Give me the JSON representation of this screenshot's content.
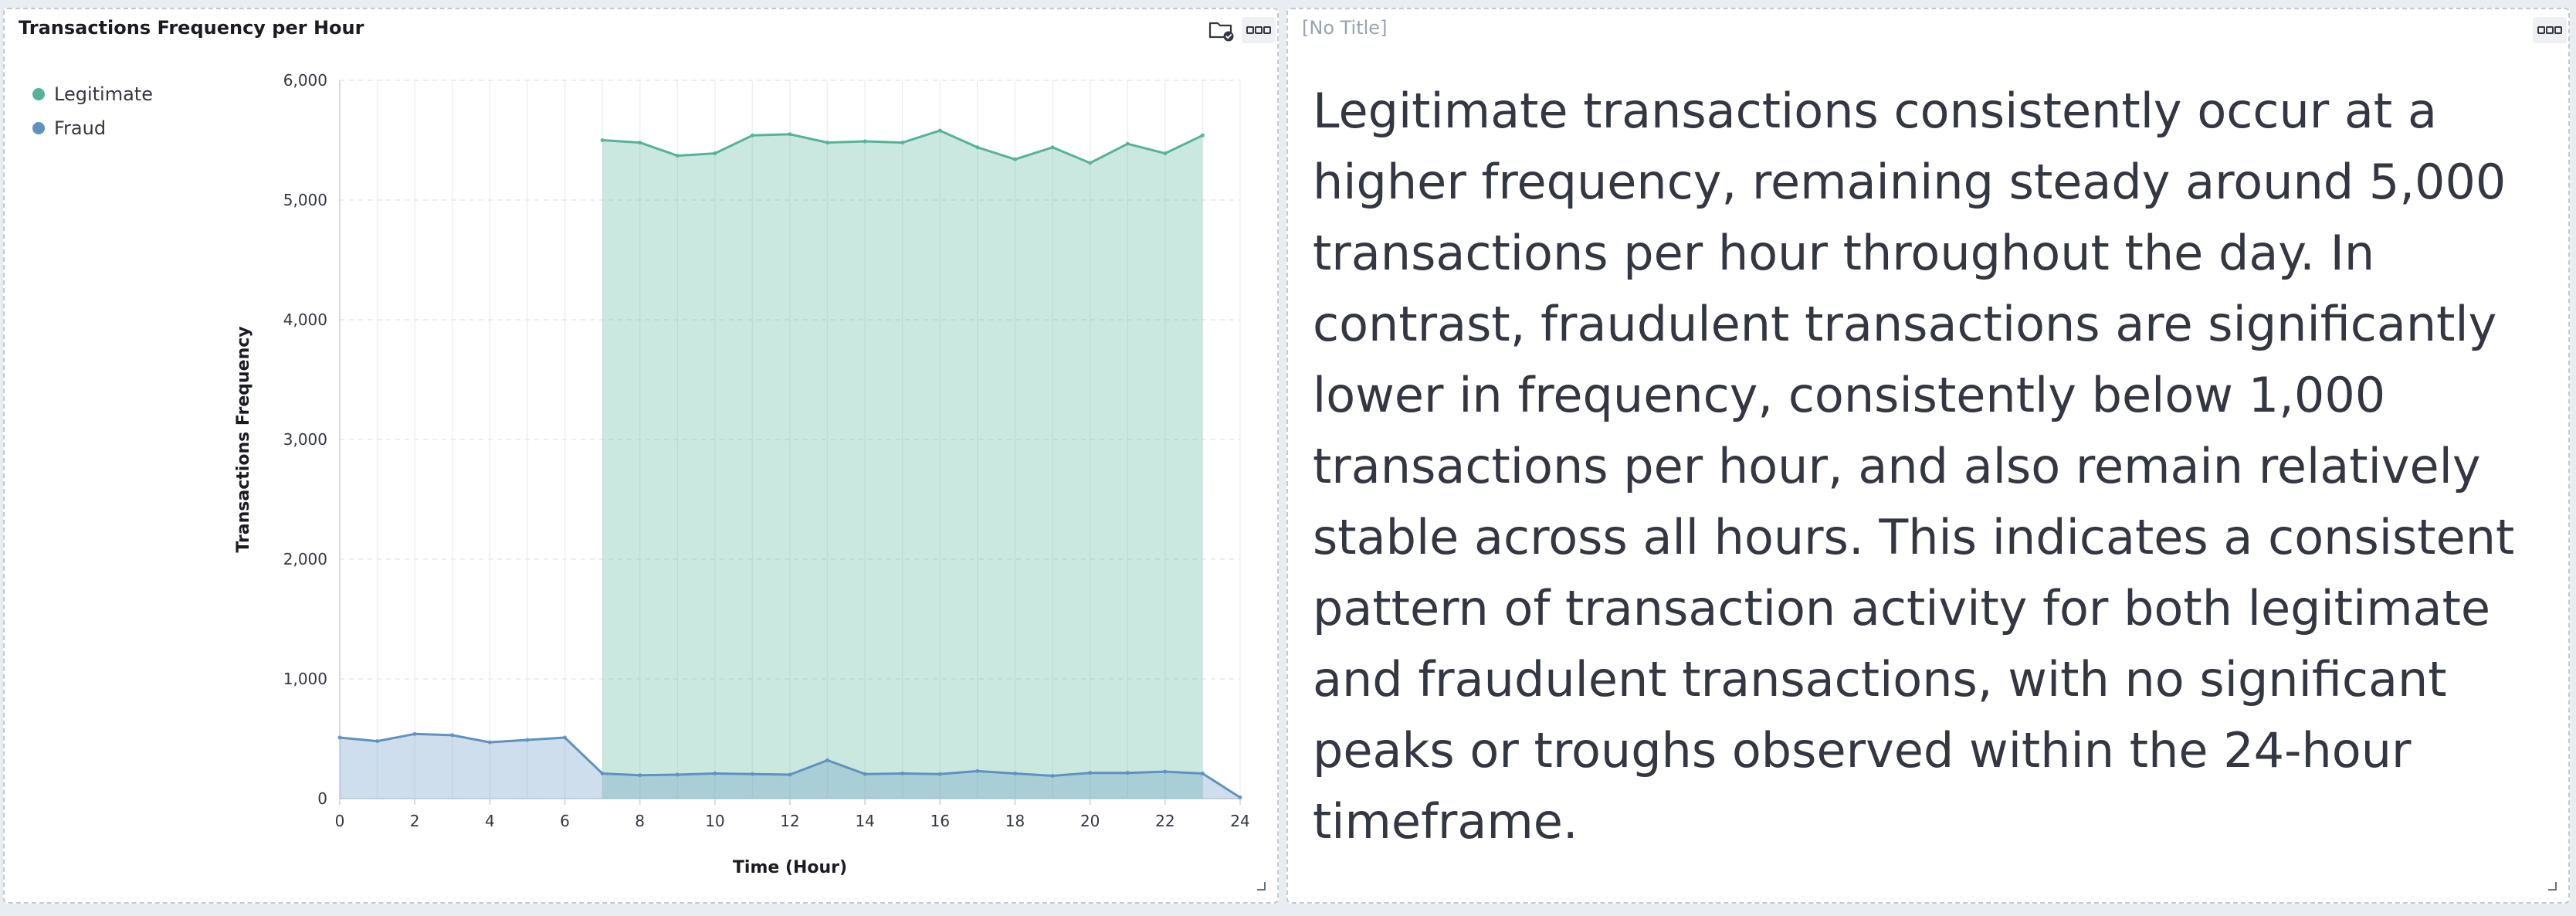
{
  "chart_panel": {
    "title": "Transactions Frequency per Hour",
    "save_icon": "folder-check-icon",
    "menu_icon": "ellipsis-icon"
  },
  "text_panel": {
    "title": "[No Title]",
    "menu_icon": "ellipsis-icon",
    "body": "Legitimate transactions consistently occur at a higher frequency, remaining steady around 5,000 transactions per hour throughout the day. In contrast, fraudulent transactions are significantly lower in frequency, consistently below 1,000 transactions per hour, and also remain relatively stable across all hours. This indicates a consistent pattern of transaction activity for both legitimate and fraudulent transactions, with no significant peaks or troughs observed within the 24-hour timeframe."
  },
  "legend": [
    {
      "label": "Legitimate",
      "color": "#54b399"
    },
    {
      "label": "Fraud",
      "color": "#6092c0"
    }
  ],
  "chart_data": {
    "type": "area",
    "title": "Transactions Frequency per Hour",
    "xlabel": "Time (Hour)",
    "ylabel": "Transactions Frequency",
    "xlim": [
      0,
      24
    ],
    "ylim": [
      0,
      6000
    ],
    "xticks": [
      "0",
      "2",
      "4",
      "6",
      "8",
      "10",
      "12",
      "14",
      "16",
      "18",
      "20",
      "22",
      "24"
    ],
    "yticks": [
      "0",
      "1,000",
      "2,000",
      "3,000",
      "4,000",
      "5,000",
      "6,000"
    ],
    "grid": true,
    "legend_position": "top-left",
    "series": [
      {
        "name": "Legitimate",
        "color": "#54b399",
        "x": [
          7,
          8,
          9,
          10,
          11,
          12,
          13,
          14,
          15,
          16,
          17,
          18,
          19,
          20,
          21,
          22,
          23
        ],
        "y": [
          5500,
          5480,
          5370,
          5390,
          5540,
          5550,
          5480,
          5490,
          5480,
          5580,
          5440,
          5340,
          5440,
          5310,
          5470,
          5390,
          5540
        ]
      },
      {
        "name": "Fraud",
        "color": "#6092c0",
        "x": [
          0,
          1,
          2,
          3,
          4,
          5,
          6,
          7,
          8,
          9,
          10,
          11,
          12,
          13,
          14,
          15,
          16,
          17,
          18,
          19,
          20,
          21,
          22,
          23,
          24
        ],
        "y": [
          510,
          480,
          540,
          530,
          470,
          490,
          510,
          210,
          195,
          200,
          210,
          205,
          200,
          320,
          205,
          210,
          205,
          230,
          210,
          190,
          215,
          215,
          225,
          210,
          10
        ]
      }
    ]
  }
}
